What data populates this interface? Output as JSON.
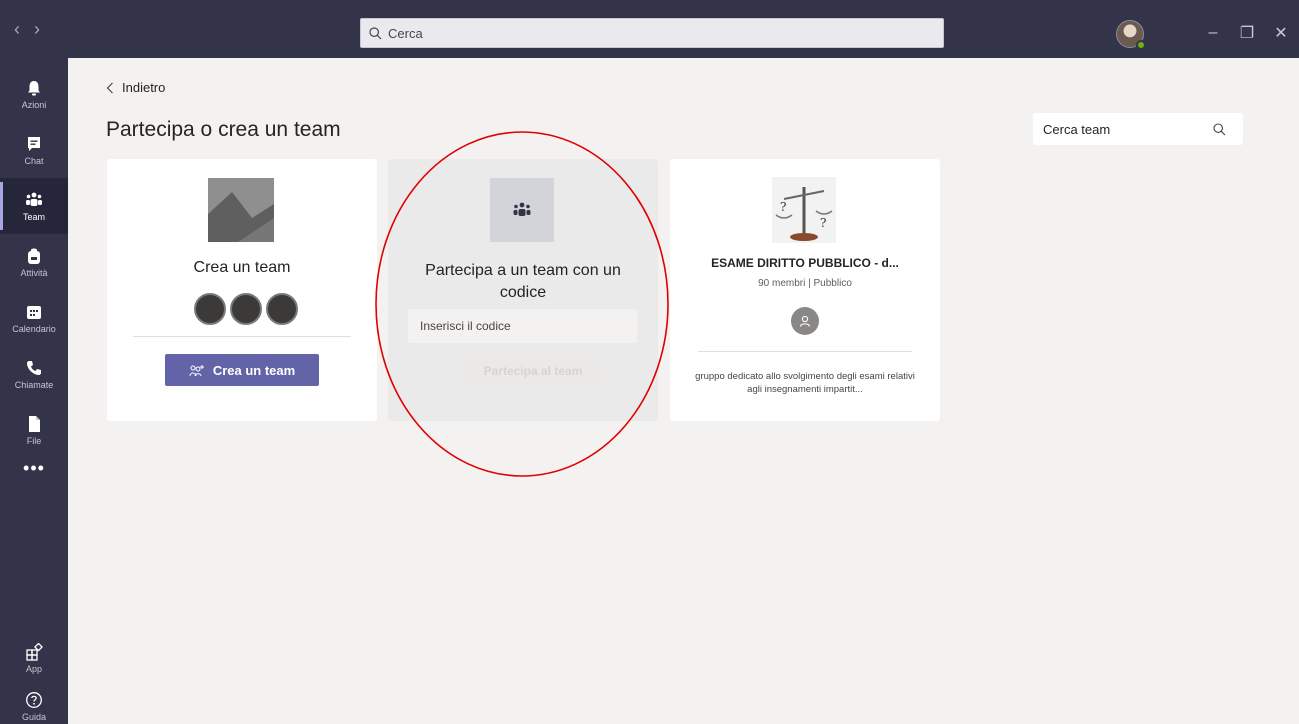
{
  "titlebar": {
    "back_arrow": "‹",
    "forward_arrow": "›",
    "search_placeholder": "Cerca",
    "window_controls": {
      "minimize": "–",
      "maximize": "❐",
      "close": "✕"
    },
    "status_color": "#6bb700"
  },
  "rail": {
    "items": [
      {
        "label": "Azioni",
        "icon": "bell-icon"
      },
      {
        "label": "Chat",
        "icon": "chat-icon"
      },
      {
        "label": "Team",
        "icon": "teams-icon",
        "active": true
      },
      {
        "label": "Attività",
        "icon": "backpack-icon"
      },
      {
        "label": "Calendario",
        "icon": "calendar-icon"
      },
      {
        "label": "Chiamate",
        "icon": "phone-icon"
      },
      {
        "label": "File",
        "icon": "file-icon"
      }
    ],
    "more": "•••",
    "bottom_items": [
      {
        "label": "App",
        "icon": "apps-icon"
      },
      {
        "label": "Guida",
        "icon": "help-icon"
      }
    ]
  },
  "content": {
    "back_label": "Indietro",
    "title": "Partecipa o crea un team",
    "team_search_placeholder": "Cerca team"
  },
  "cards": {
    "create": {
      "title": "Crea un team",
      "button_label": "Crea un team"
    },
    "join": {
      "title": "Partecipa a un team con un codice",
      "code_placeholder": "Inserisci il codice",
      "button_label": "Partecipa al team"
    },
    "team": {
      "name": "ESAME DIRITTO PUBBLICO - d...",
      "meta": "90 membri | Pubblico",
      "description": "gruppo dedicato allo svolgimento degli esami relativi agli insegnamenti impartit..."
    }
  },
  "colors": {
    "rail_bg": "#33344a",
    "accent": "#6264a7",
    "annotation": "#e00000"
  }
}
